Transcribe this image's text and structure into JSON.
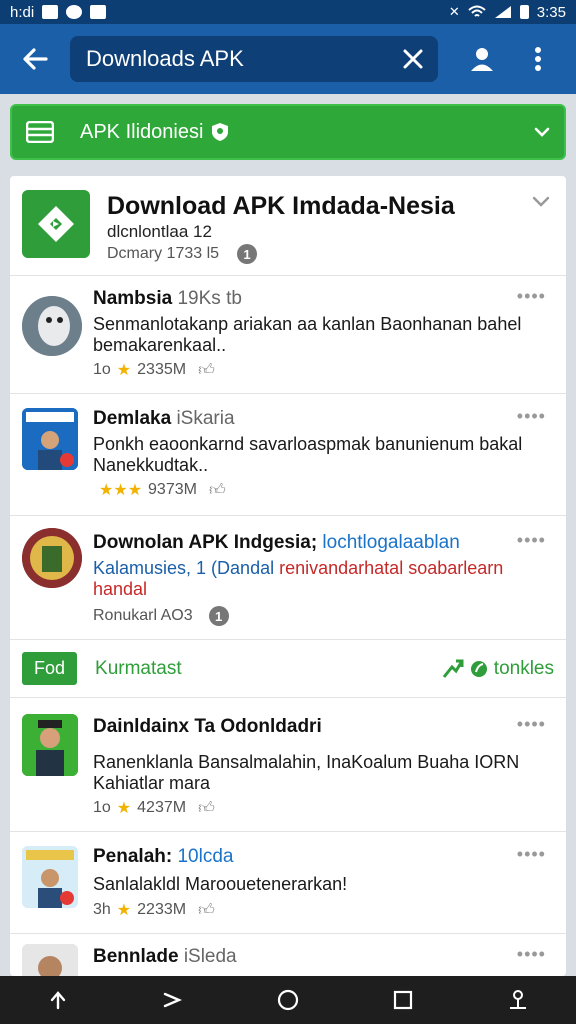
{
  "status": {
    "time": "h:di",
    "battery_text": "3:35"
  },
  "search": {
    "query": "Downloads APK"
  },
  "filter": {
    "label": "APK Ilidoniesi"
  },
  "header": {
    "title": "Download APK Imdada-Nesia",
    "subtitle": "dlcnlontlaa 12",
    "meta": "Dcmary 1733 l5",
    "info": "1"
  },
  "items": [
    {
      "name": "Nambsia",
      "tag": "19Ks tb",
      "desc": "Senmanlotakanp ariakan aa kanlan Baonhanan bahel bemakarenkaal..",
      "rating": "1o",
      "stars": "★",
      "size": "2335M"
    },
    {
      "name": "Demlaka",
      "tag": "iSkaria",
      "desc": "Ponkh eaoonkarnd savarloaspmak banunienum bakal Nanekkudtak..",
      "rating": "",
      "stars": "★★★",
      "size": "9373M"
    },
    {
      "name": "Downolan APK Indgesia;",
      "tag": "lochtlogalaablan",
      "desc_blue": "Kalamusies, 1 (Dandal",
      "desc_red": "renivandarhatal soabarlearn handal",
      "meta": "Ronukarl AO3",
      "info": "1"
    },
    {
      "name": "Dainldainx Ta Odonldadri",
      "tag": "",
      "desc": "Ranenklanla Bansalmalahin, InaKoalum Buaha IORN Kahiatlar mara",
      "rating": "1o",
      "stars": "★",
      "size": "4237M"
    },
    {
      "name": "Penalah:",
      "tag": "10lcda",
      "desc": "Sanlalakldl Maroouetenerarkan!",
      "rating": "3h",
      "stars": "★",
      "size": "2233M"
    },
    {
      "name": "Bennlade",
      "tag": "iSleda",
      "desc": "",
      "rating": "",
      "stars": "",
      "size": ""
    }
  ],
  "section": {
    "pill": "Fod",
    "title": "Kurmatast",
    "link": "tonkles"
  },
  "colors": {
    "appbar": "#1a5fa8",
    "accent_green": "#2fa83a",
    "star": "#f2b300"
  }
}
